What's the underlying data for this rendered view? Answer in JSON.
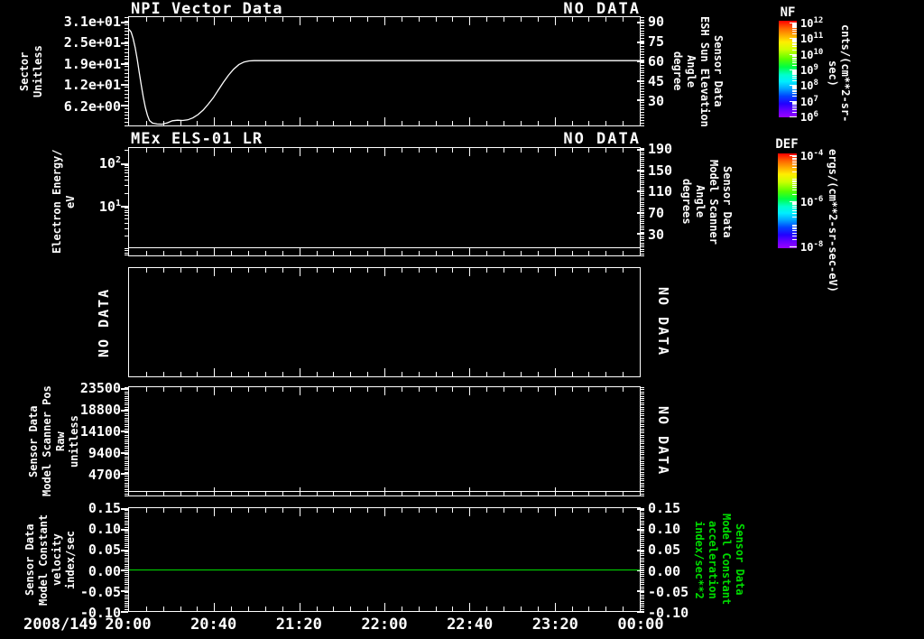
{
  "app": {
    "background": "#000000",
    "foreground": "#ffffff",
    "accent_green": "#00dd00"
  },
  "xaxis": {
    "date_label": "2008/149",
    "tick_labels": [
      "20:00",
      "20:40",
      "21:20",
      "22:00",
      "22:40",
      "23:20",
      "00:00"
    ]
  },
  "panels": [
    {
      "title": "NPI Vector Data",
      "no_data": "NO DATA",
      "left_label_lines": [
        "Sector",
        "Unitless"
      ],
      "right_label_lines": [
        "Sensor Data",
        "ESH Sun Elevation",
        "Angle",
        "degree"
      ],
      "left_ticks": [
        {
          "label": "3.1e+01",
          "frac": 0.041
        },
        {
          "label": "2.5e+01",
          "frac": 0.233
        },
        {
          "label": "1.9e+01",
          "frac": 0.425
        },
        {
          "label": "1.2e+01",
          "frac": 0.617
        },
        {
          "label": "6.2e+00",
          "frac": 0.808
        }
      ],
      "right_ticks": [
        {
          "label": "90",
          "frac": 0.041
        },
        {
          "label": "75",
          "frac": 0.221
        },
        {
          "label": "60",
          "frac": 0.402
        },
        {
          "label": "45",
          "frac": 0.582
        },
        {
          "label": "30",
          "frac": 0.762
        }
      ],
      "left_minor_count": 31,
      "right_minor_count": 41,
      "curve": {
        "color": "#ffffff",
        "points": [
          [
            0.0,
            0.113
          ],
          [
            0.004,
            0.137
          ],
          [
            0.008,
            0.197
          ],
          [
            0.012,
            0.281
          ],
          [
            0.016,
            0.39
          ],
          [
            0.02,
            0.51
          ],
          [
            0.024,
            0.63
          ],
          [
            0.028,
            0.738
          ],
          [
            0.032,
            0.834
          ],
          [
            0.036,
            0.906
          ],
          [
            0.04,
            0.954
          ],
          [
            0.046,
            0.978
          ],
          [
            0.055,
            0.987
          ],
          [
            0.065,
            0.988
          ],
          [
            0.075,
            0.976
          ],
          [
            0.085,
            0.957
          ],
          [
            0.095,
            0.952
          ],
          [
            0.105,
            0.954
          ],
          [
            0.115,
            0.948
          ],
          [
            0.125,
            0.93
          ],
          [
            0.135,
            0.9
          ],
          [
            0.145,
            0.858
          ],
          [
            0.155,
            0.804
          ],
          [
            0.165,
            0.744
          ],
          [
            0.175,
            0.672
          ],
          [
            0.185,
            0.6
          ],
          [
            0.195,
            0.534
          ],
          [
            0.205,
            0.48
          ],
          [
            0.215,
            0.438
          ],
          [
            0.225,
            0.414
          ],
          [
            0.235,
            0.404
          ],
          [
            0.245,
            0.402
          ],
          [
            1.0,
            0.402
          ]
        ]
      }
    },
    {
      "title": "MEx ELS-01 LR",
      "no_data": "NO DATA",
      "left_label_lines": [
        "Electron Energy/",
        "eV"
      ],
      "right_label_lines": [
        "Sensor Data",
        "Model Scanner",
        "Angle",
        "degrees"
      ],
      "left_ticks": [
        {
          "base": "10",
          "exp": "2",
          "frac": 0.14
        },
        {
          "base": "10",
          "exp": "1",
          "frac": 0.537
        }
      ],
      "left_minor_fracs": [
        0.021,
        0.158,
        0.178,
        0.201,
        0.228,
        0.259,
        0.298,
        0.347,
        0.417,
        0.555,
        0.576,
        0.598,
        0.625,
        0.656,
        0.694,
        0.744,
        0.814,
        0.934,
        0.952,
        0.972,
        0.995
      ],
      "right_ticks": [
        {
          "label": "190",
          "frac": 0.008
        },
        {
          "label": "150",
          "frac": 0.204
        },
        {
          "label": "110",
          "frac": 0.399
        },
        {
          "label": "70",
          "frac": 0.595
        },
        {
          "label": "30",
          "frac": 0.79
        }
      ],
      "right_minor_count": 50,
      "hline": {
        "frac": 0.926,
        "color": "#ffffff"
      }
    },
    {
      "no_data_left": "NO DATA",
      "no_data_right": "NO DATA"
    },
    {
      "no_data_right": "NO DATA",
      "left_label_lines": [
        "Sensor Data",
        "Model Scanner Pos",
        "Raw",
        "unitless"
      ],
      "left_ticks": [
        {
          "label": "23500",
          "frac": 0.012
        },
        {
          "label": "18800",
          "frac": 0.207
        },
        {
          "label": "14100",
          "frac": 0.402
        },
        {
          "label": "9400",
          "frac": 0.598
        },
        {
          "label": "4700",
          "frac": 0.795
        }
      ],
      "left_minor_count": 50,
      "right_minor_count": 50,
      "hline": {
        "frac": 0.958,
        "color": "#ffffff"
      }
    },
    {
      "left_label_lines": [
        "Sensor Data",
        "Model Constant",
        "velocity",
        "index/sec"
      ],
      "right_label_lines_green": [
        "Sensor Data",
        "Model Constant",
        "acceleration",
        "index/sec**2"
      ],
      "left_ticks": [
        {
          "label": "0.15",
          "frac": 0.0
        },
        {
          "label": "0.10",
          "frac": 0.2
        },
        {
          "label": "0.05",
          "frac": 0.4
        },
        {
          "label": "0.00",
          "frac": 0.6
        },
        {
          "label": "-0.05",
          "frac": 0.8
        },
        {
          "label": "-0.10",
          "frac": 1.0
        }
      ],
      "right_ticks": [
        {
          "label": "0.15",
          "frac": 0.0
        },
        {
          "label": "0.10",
          "frac": 0.2
        },
        {
          "label": "0.05",
          "frac": 0.4
        },
        {
          "label": "0.00",
          "frac": 0.6
        },
        {
          "label": "-0.05",
          "frac": 0.8
        },
        {
          "label": "-0.10",
          "frac": 1.0
        }
      ],
      "left_minor_count": 50,
      "right_minor_count": 50,
      "hline": {
        "frac": 0.6,
        "color": "#00dd00"
      }
    }
  ],
  "colorbars": [
    {
      "title": "NF",
      "unit": "cnts/(cm**2-sr-sec)",
      "tick_exps": [
        "12",
        "11",
        "10",
        "9",
        "8",
        "7",
        "6"
      ],
      "tick_fracs": [
        0.02,
        0.182,
        0.344,
        0.506,
        0.668,
        0.83,
        0.99
      ],
      "decades": 6
    },
    {
      "title": "DEF",
      "unit": "ergs/(cm**2-sr-sec-eV)",
      "tick_exps": [
        "-4",
        "-6",
        "-8"
      ],
      "tick_fracs": [
        0.02,
        0.5,
        0.98
      ],
      "decades": 4
    }
  ],
  "chart_data": [
    {
      "type": "line",
      "title": "NPI Vector Data",
      "status": "NO DATA",
      "left_axis": {
        "label": "Sector Unitless",
        "ticks": [
          31,
          24.8,
          18.6,
          12.4,
          6.2
        ]
      },
      "right_axis": {
        "label": "Sensor Data ESH Sun Elevation Angle degree",
        "ticks": [
          90,
          75,
          60,
          45,
          30
        ]
      },
      "x_range": [
        "2008/149 20:00",
        "2008/150 00:00"
      ],
      "series": [
        {
          "name": "sun-elevation-angle-deg",
          "points": [
            [
              "20:00",
              84
            ],
            [
              "20:08",
              20
            ],
            [
              "20:14",
              11
            ],
            [
              "20:26",
              14
            ],
            [
              "20:40",
              31
            ],
            [
              "20:52",
              50
            ],
            [
              "20:59",
              60
            ],
            [
              "00:00",
              60
            ]
          ]
        }
      ]
    },
    {
      "type": "heatmap",
      "title": "MEx ELS-01 LR",
      "status": "NO DATA",
      "left_axis": {
        "label": "Electron Energy/ eV",
        "scale": "log",
        "ticks": [
          100,
          10
        ]
      },
      "right_axis": {
        "label": "Sensor Data Model Scanner Angle degrees",
        "ticks": [
          190,
          150,
          110,
          70,
          30
        ]
      },
      "series": [
        {
          "name": "flat-energy-trace",
          "constant_value_eV": 1.1
        }
      ]
    },
    {
      "type": "empty",
      "status_left": "NO DATA",
      "status_right": "NO DATA"
    },
    {
      "type": "line",
      "status_right": "NO DATA",
      "left_axis": {
        "label": "Sensor Data Model Scanner Pos Raw unitless",
        "ticks": [
          23500,
          18800,
          14100,
          9400,
          4700
        ]
      },
      "series": [
        {
          "name": "scanner-pos",
          "constant_value": 900
        }
      ]
    },
    {
      "type": "line",
      "left_axis": {
        "label": "Sensor Data Model Constant velocity index/sec",
        "ticks": [
          0.15,
          0.1,
          0.05,
          0.0,
          -0.05,
          -0.1
        ]
      },
      "right_axis": {
        "label": "Sensor Data Model Constant acceleration index/sec**2",
        "ticks": [
          0.15,
          0.1,
          0.05,
          0.0,
          -0.05,
          -0.1
        ]
      },
      "series": [
        {
          "name": "constant-velocity",
          "constant_value": 0.0
        }
      ]
    }
  ]
}
